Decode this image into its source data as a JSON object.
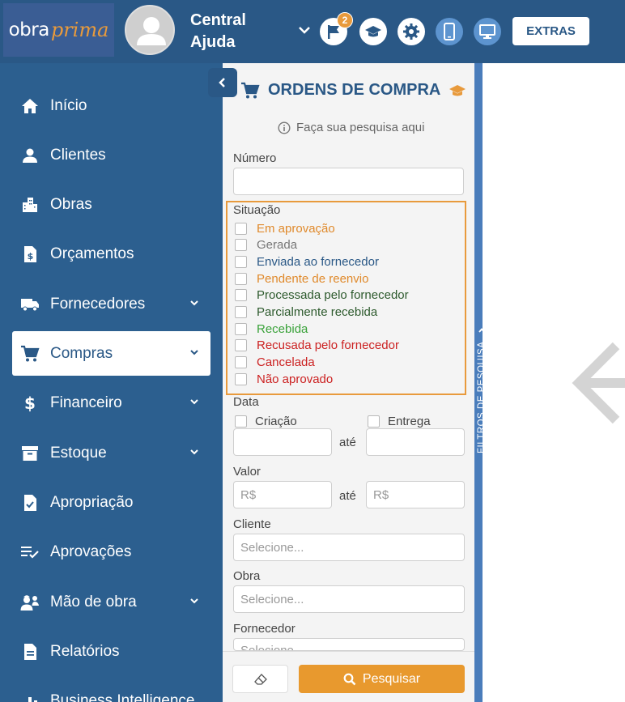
{
  "header": {
    "logo_part1": "obra",
    "logo_part2": "prima",
    "user_name": "Central Ajuda",
    "notification_count": "2",
    "extras_label": "EXTRAS"
  },
  "sidebar": {
    "items": [
      {
        "label": "Início",
        "icon": "home-icon"
      },
      {
        "label": "Clientes",
        "icon": "person-icon"
      },
      {
        "label": "Obras",
        "icon": "buildings-icon"
      },
      {
        "label": "Orçamentos",
        "icon": "dollar-file-icon"
      },
      {
        "label": "Fornecedores",
        "icon": "truck-icon"
      },
      {
        "label": "Compras",
        "icon": "cart-icon"
      },
      {
        "label": "Financeiro",
        "icon": "dollar-icon"
      },
      {
        "label": "Estoque",
        "icon": "archive-icon"
      },
      {
        "label": "Apropriação",
        "icon": "file-check-icon"
      },
      {
        "label": "Aprovações",
        "icon": "list-check-icon"
      },
      {
        "label": "Mão de obra",
        "icon": "workers-icon"
      },
      {
        "label": "Relatórios",
        "icon": "document-icon"
      },
      {
        "label": "Business Intelligence",
        "icon": "bar-chart-icon"
      }
    ],
    "active": "Compras"
  },
  "panel": {
    "title": "ORDENS DE COMPRA",
    "hint": "Faça sua pesquisa aqui",
    "numero_label": "Número",
    "situacao_label": "Situação",
    "situacoes": [
      {
        "label": "Em aprovação",
        "color": "#e08a2c"
      },
      {
        "label": "Gerada",
        "color": "#777777"
      },
      {
        "label": "Enviada ao fornecedor",
        "color": "#2a5886"
      },
      {
        "label": "Pendente de reenvio",
        "color": "#e08a2c"
      },
      {
        "label": "Processada pelo fornecedor",
        "color": "#2d5a2d"
      },
      {
        "label": "Parcialmente recebida",
        "color": "#2d5a2d"
      },
      {
        "label": "Recebida",
        "color": "#3aa23a"
      },
      {
        "label": "Recusada pelo fornecedor",
        "color": "#cc2222"
      },
      {
        "label": "Cancelada",
        "color": "#cc2222"
      },
      {
        "label": "Não aprovado",
        "color": "#cc2222"
      }
    ],
    "data_label": "Data",
    "criacao_label": "Criação",
    "entrega_label": "Entrega",
    "ate_label": "até",
    "valor_label": "Valor",
    "valor_placeholder": "R$",
    "cliente_label": "Cliente",
    "obra_label": "Obra",
    "fornecedor_label": "Fornecedor",
    "select_placeholder": "Selecione...",
    "search_label": "Pesquisar"
  },
  "filter_tab": {
    "label": "FILTROS DE PESQUISA"
  },
  "colors": {
    "header": "#2a5886",
    "sidebar": "#2c5f8f",
    "accent": "#e89a3c",
    "panel": "#f4f4f4"
  }
}
